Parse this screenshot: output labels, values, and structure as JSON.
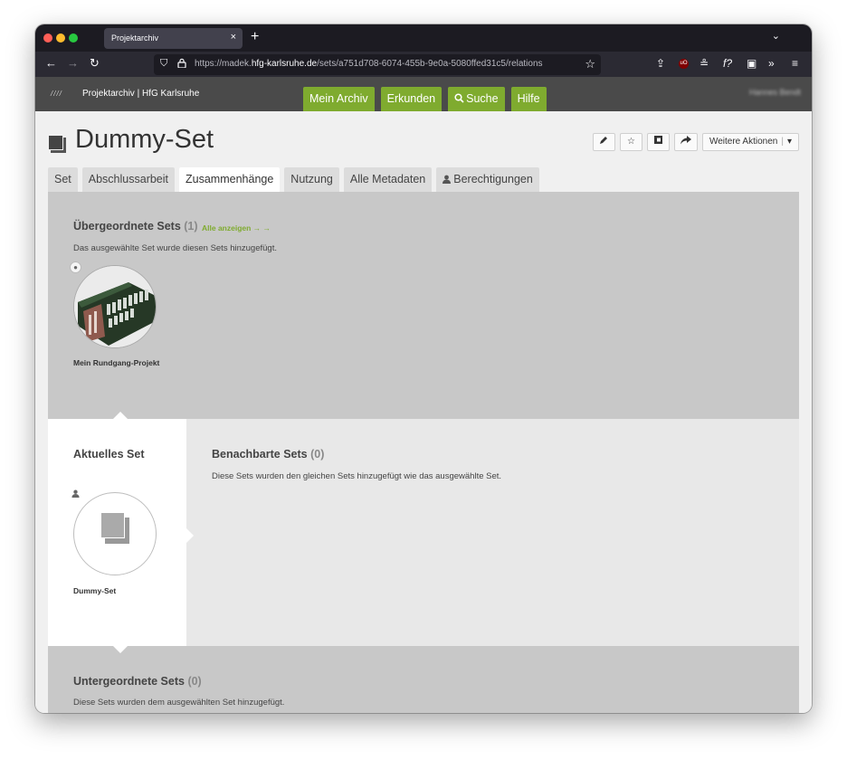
{
  "browser": {
    "tab_title": "Projektarchiv",
    "tab_close": "×",
    "new_tab": "+",
    "tab_list": "⌄",
    "url_prefix": "https://madek.",
    "url_domain": "hfg-karlsruhe.de",
    "url_path": "/sets/a751d708-6074-455b-9e0a-5080ffed31c5/relations"
  },
  "site": {
    "logo_text": "////",
    "name": "Projektarchiv | HfG Karlsruhe",
    "nav": [
      "Mein Archiv",
      "Erkunden",
      "Suche",
      "Hilfe"
    ],
    "search_icon": "search-icon",
    "user_name": "Hannes Bendt"
  },
  "page": {
    "title": "Dummy-Set",
    "actions": {
      "edit_icon": "pencil-icon",
      "favorite_icon": "star-icon",
      "copy_icon": "copy-icon",
      "share_icon": "share-icon",
      "more_label": "Weitere Aktionen",
      "more_caret": "▾"
    },
    "tabs": [
      "Set",
      "Abschlussarbeit",
      "Zusammenhänge",
      "Nutzung",
      "Alle Metadaten",
      "Berechtigungen"
    ],
    "active_tab": "Zusammenhänge"
  },
  "parents": {
    "title": "Übergeordnete Sets",
    "count": "(1)",
    "show_all": "Alle anzeigen → →",
    "description": "Das ausgewählte Set wurde diesen Sets hinzugefügt.",
    "items": [
      {
        "label": "Mein Rundgang-Projekt"
      }
    ]
  },
  "current": {
    "title": "Aktuelles Set",
    "label": "Dummy-Set"
  },
  "neighbors": {
    "title": "Benachbarte Sets",
    "count": "(0)",
    "description": "Diese Sets wurden den gleichen Sets hinzugefügt wie das ausgewählte Set."
  },
  "children": {
    "title": "Untergeordnete Sets",
    "count": "(0)",
    "description": "Diese Sets wurden dem ausgewählten Set hinzugefügt."
  },
  "colors": {
    "accent_green": "#7fab2f",
    "header_gray": "#4a4a4a",
    "section_gray": "#c8c8c8"
  }
}
